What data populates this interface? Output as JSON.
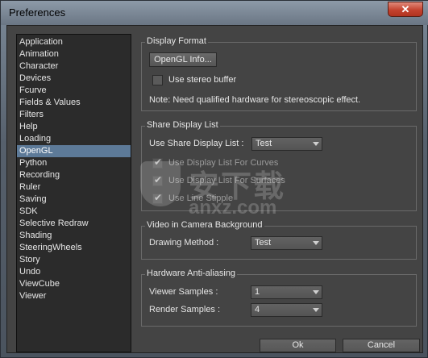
{
  "window": {
    "title": "Preferences",
    "close_symbol": "✕"
  },
  "sidebar": {
    "items": [
      {
        "label": "Application"
      },
      {
        "label": "Animation"
      },
      {
        "label": "Character"
      },
      {
        "label": "Devices"
      },
      {
        "label": "Fcurve"
      },
      {
        "label": "Fields & Values"
      },
      {
        "label": "Filters"
      },
      {
        "label": "Help"
      },
      {
        "label": "Loading"
      },
      {
        "label": "OpenGL",
        "selected": true
      },
      {
        "label": "Python"
      },
      {
        "label": "Recording"
      },
      {
        "label": "Ruler"
      },
      {
        "label": "Saving"
      },
      {
        "label": "SDK"
      },
      {
        "label": "Selective Redraw"
      },
      {
        "label": "Shading"
      },
      {
        "label": "SteeringWheels"
      },
      {
        "label": "Story"
      },
      {
        "label": "Undo"
      },
      {
        "label": "ViewCube"
      },
      {
        "label": "Viewer"
      }
    ]
  },
  "display_format": {
    "title": "Display Format",
    "opengl_info_button": "OpenGL Info...",
    "stereo_label": "Use stereo buffer",
    "stereo_checked": false,
    "note": "Note: Need qualified hardware for stereoscopic effect."
  },
  "share_display_list": {
    "title": "Share Display List",
    "use_label": "Use Share Display List :",
    "use_value": "Test",
    "curves_label": "Use Display List For Curves",
    "surfaces_label": "Use Display List For Surfaces",
    "stipple_label": "Use Line Stipple",
    "curves_checked": true,
    "surfaces_checked": true,
    "stipple_checked": true
  },
  "video_background": {
    "title": "Video in Camera Background",
    "method_label": "Drawing Method :",
    "method_value": "Test"
  },
  "anti_aliasing": {
    "title": "Hardware Anti-aliasing",
    "viewer_label": "Viewer Samples :",
    "viewer_value": "1",
    "render_label": "Render Samples :",
    "render_value": "4"
  },
  "footer": {
    "ok_label": "Ok",
    "cancel_label": "Cancel"
  },
  "watermark": {
    "text": "安下载",
    "sub": "anxz.com"
  }
}
